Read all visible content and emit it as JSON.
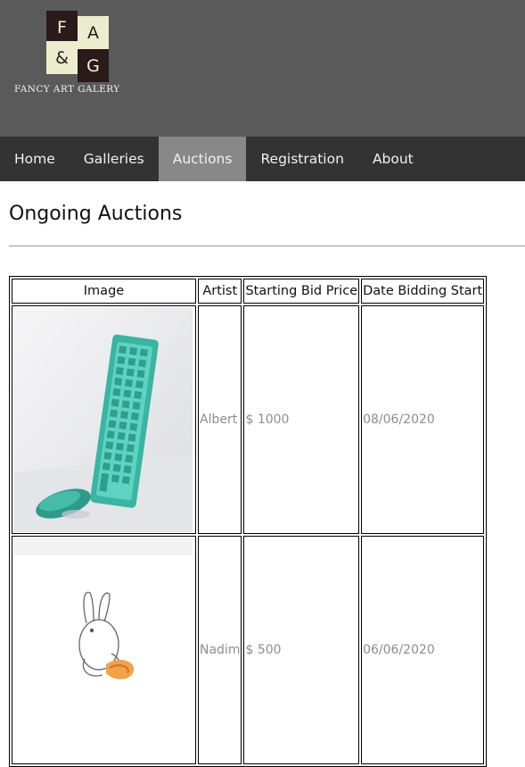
{
  "brand": {
    "logo_letters": [
      "F",
      "A",
      "&",
      "G"
    ],
    "name": "FANCY ART GALERY"
  },
  "nav": {
    "items": [
      {
        "label": "Home"
      },
      {
        "label": "Galleries"
      },
      {
        "label": "Auctions",
        "active": true
      },
      {
        "label": "Registration"
      },
      {
        "label": "About"
      }
    ]
  },
  "main": {
    "title": "Ongoing Auctions"
  },
  "table": {
    "headers": [
      "Image",
      "Artist",
      "Starting Bid Price",
      "Date Bidding Start"
    ],
    "rows": [
      {
        "image": "keyboard-and-mouse-photo",
        "artist": "Albert",
        "price": "$ 1000",
        "date": "08/06/2020"
      },
      {
        "image": "rabbit-drawing",
        "artist": "Nadim",
        "price": "$ 500",
        "date": "06/06/2020"
      }
    ]
  },
  "colors": {
    "header_bg": "#5a5a5a",
    "nav_bg": "#333333",
    "nav_active_bg": "#888888",
    "cell_text": "#8d8d8d"
  }
}
